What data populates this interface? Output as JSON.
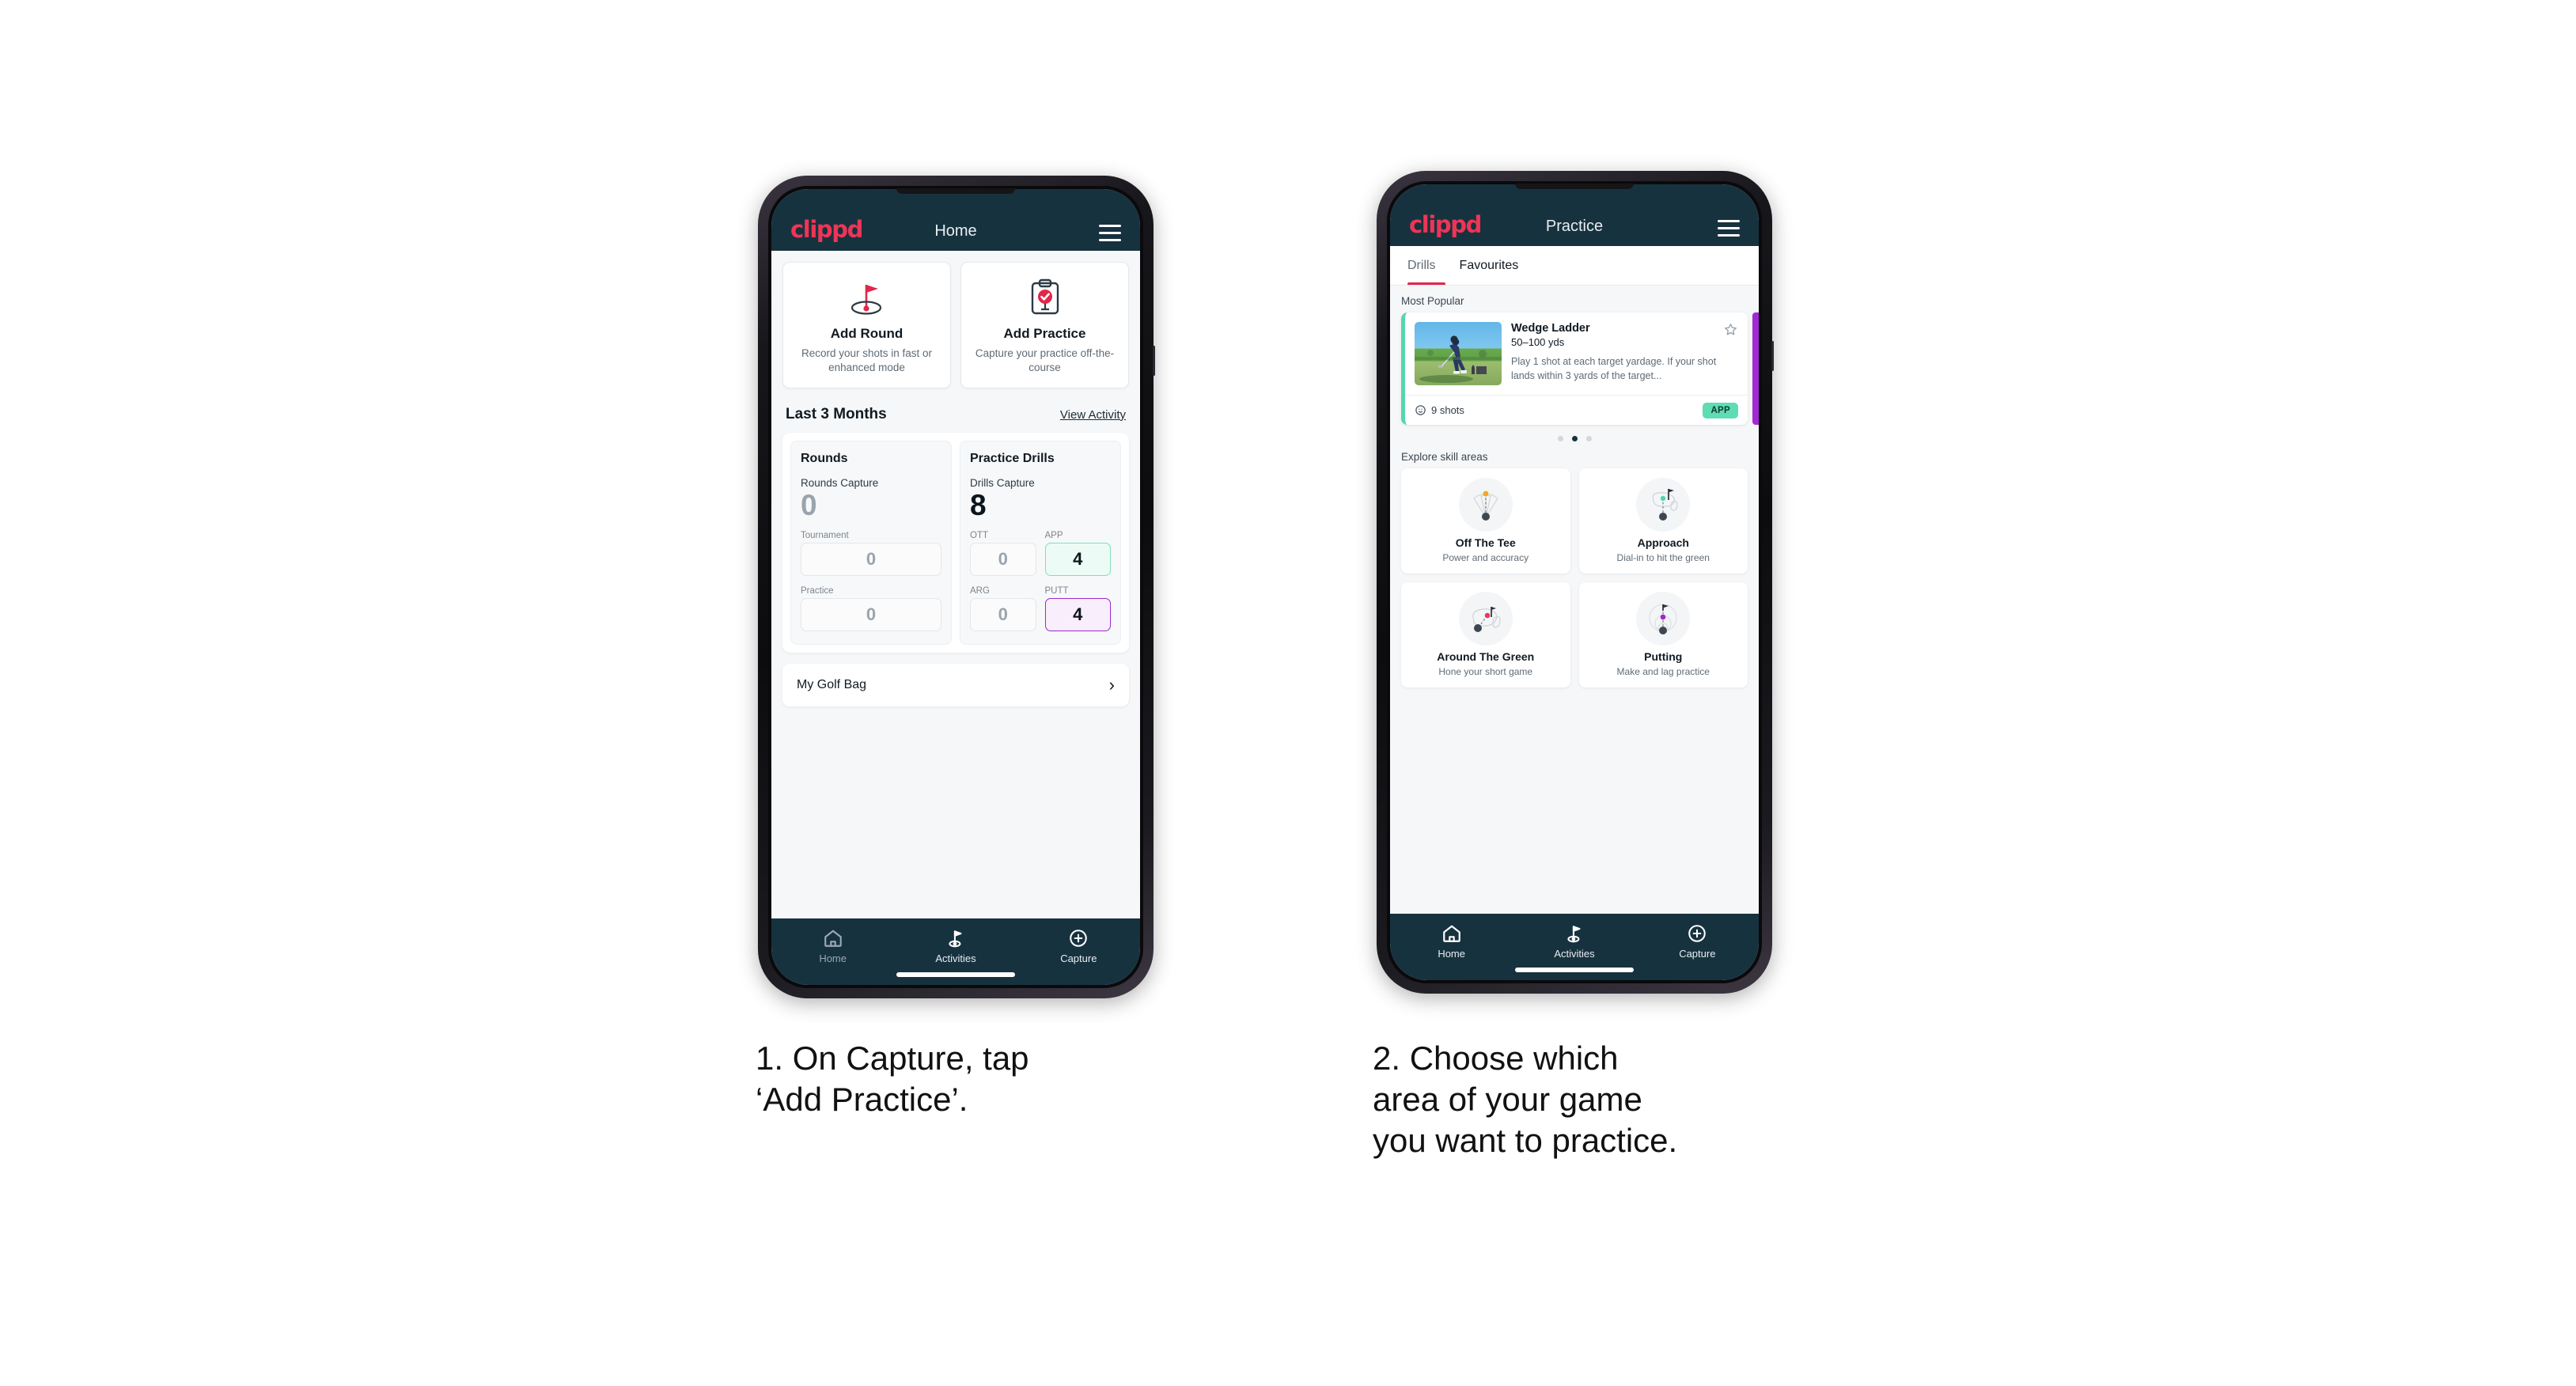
{
  "phone1": {
    "header": {
      "brand": "clippd",
      "title": "Home",
      "menu_icon": "hamburger-menu-icon"
    },
    "actions": [
      {
        "icon": "golf-flag-hole-icon",
        "title": "Add Round",
        "subtitle": "Record your shots in fast or enhanced mode"
      },
      {
        "icon": "clipboard-check-icon",
        "title": "Add Practice",
        "subtitle": "Capture your practice off-the-course"
      }
    ],
    "section": {
      "title": "Last 3 Months",
      "link": "View Activity"
    },
    "rounds": {
      "title": "Rounds",
      "capture_label": "Rounds Capture",
      "capture_value": "0",
      "fields": [
        {
          "label": "Tournament",
          "value": "0",
          "state": "empty"
        },
        {
          "label": "Practice",
          "value": "0",
          "state": "empty"
        }
      ]
    },
    "drills": {
      "title": "Practice Drills",
      "capture_label": "Drills Capture",
      "capture_value": "8",
      "fields": [
        {
          "label": "OTT",
          "value": "0",
          "state": "empty"
        },
        {
          "label": "APP",
          "value": "4",
          "state": "green"
        },
        {
          "label": "ARG",
          "value": "0",
          "state": "empty"
        },
        {
          "label": "PUTT",
          "value": "4",
          "state": "purple"
        }
      ]
    },
    "golf_bag": {
      "label": "My Golf Bag",
      "chevron": "chevron-right-icon"
    },
    "nav": [
      {
        "label": "Home",
        "icon": "home-icon",
        "active": true,
        "color": "#ee3556"
      },
      {
        "label": "Activities",
        "icon": "golf-flag-icon",
        "active": false
      },
      {
        "label": "Capture",
        "icon": "plus-circle-icon",
        "active": false
      }
    ]
  },
  "phone2": {
    "header": {
      "brand": "clippd",
      "title": "Practice",
      "menu_icon": "hamburger-menu-icon"
    },
    "tabs": [
      {
        "label": "Drills",
        "active": true
      },
      {
        "label": "Favourites",
        "active": false
      }
    ],
    "most_popular_label": "Most Popular",
    "drill_card": {
      "title": "Wedge Ladder",
      "range": "50–100 yds",
      "description": "Play 1 shot at each target yardage. If your shot lands within 3 yards of the target...",
      "shots": "9 shots",
      "shots_icon": "clock-icon",
      "badge": "APP",
      "favourite_icon": "star-outline-icon",
      "thumbnail": "golfer-chipping-photo",
      "accent_color": "#55d6aa"
    },
    "carousel_dots": {
      "count": 3,
      "active_index": 1
    },
    "explore_label": "Explore skill areas",
    "skills": [
      {
        "name": "Off The Tee",
        "sub": "Power and accuracy",
        "icon": "tee-dispersion-icon",
        "dot_color": "#f5a623"
      },
      {
        "name": "Approach",
        "sub": "Dial-in to hit the green",
        "icon": "approach-green-icon",
        "dot_color": "#4fd6b0"
      },
      {
        "name": "Around The Green",
        "sub": "Hone your short game",
        "icon": "chip-green-icon",
        "dot_color": "#e8385f"
      },
      {
        "name": "Putting",
        "sub": "Make and lag practice",
        "icon": "putting-rings-icon",
        "dot_color": "#9b29cd"
      }
    ],
    "nav": [
      {
        "label": "Home",
        "icon": "home-icon",
        "active": false
      },
      {
        "label": "Activities",
        "icon": "golf-flag-icon",
        "active": true
      },
      {
        "label": "Capture",
        "icon": "plus-circle-icon",
        "active": false
      }
    ]
  },
  "captions": {
    "step1": "1. On Capture, tap\n‘Add Practice’.",
    "step2": "2. Choose which\narea of your game\nyou want to practice."
  },
  "colors": {
    "brand_pink": "#ee3556",
    "header_dark": "#17323f",
    "accent_green": "#5fdcb3",
    "accent_purple": "#9b29cd",
    "page_bg": "#f6f7f8"
  }
}
